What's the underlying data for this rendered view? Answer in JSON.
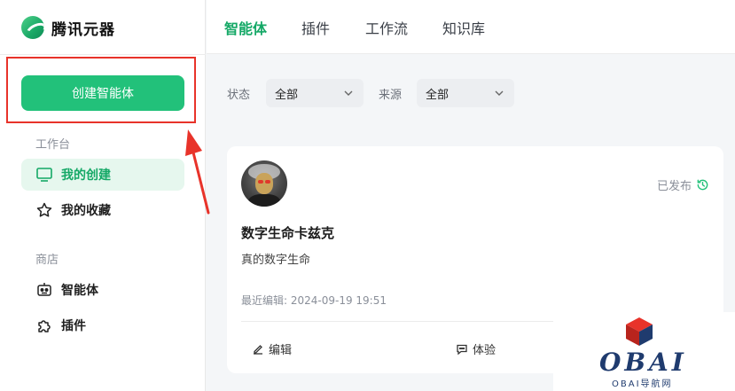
{
  "app": {
    "logo_text": "腾讯元器"
  },
  "sidebar": {
    "create_button": "创建智能体",
    "workspace_label": "工作台",
    "workspace_items": [
      {
        "label": "我的创建",
        "icon": "monitor-icon",
        "active": true
      },
      {
        "label": "我的收藏",
        "icon": "star-icon",
        "active": false
      }
    ],
    "store_label": "商店",
    "store_items": [
      {
        "label": "智能体",
        "icon": "robot-icon"
      },
      {
        "label": "插件",
        "icon": "puzzle-icon"
      }
    ]
  },
  "header": {
    "tabs": [
      {
        "label": "智能体",
        "active": true
      },
      {
        "label": "插件",
        "active": false
      },
      {
        "label": "工作流",
        "active": false
      },
      {
        "label": "知识库",
        "active": false
      }
    ]
  },
  "filters": {
    "status_label": "状态",
    "status_value": "全部",
    "source_label": "来源",
    "source_value": "全部"
  },
  "card": {
    "status": "已发布",
    "title": "数字生命卡兹克",
    "description": "真的数字生命",
    "last_edited": "最近编辑: 2024-09-19 19:51",
    "edit_label": "编辑",
    "try_label": "体验"
  },
  "watermark": {
    "brand": "OBAI",
    "subtitle": "OBAI导航网"
  },
  "colors": {
    "accent": "#22c17a",
    "accent_text": "#14a866",
    "annotation": "#e8332a",
    "watermark": "#1f3b6e"
  }
}
